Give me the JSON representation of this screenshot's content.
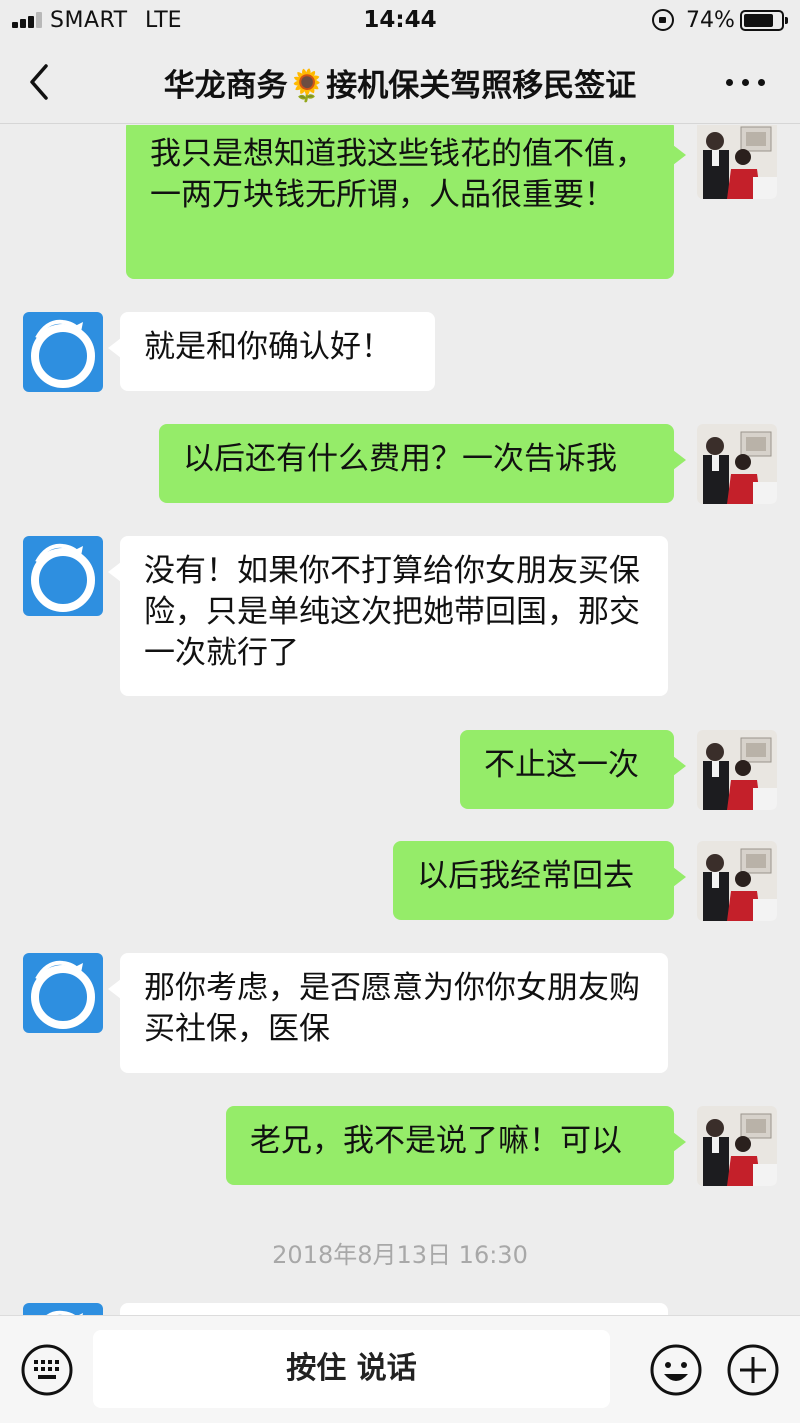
{
  "status_bar": {
    "carrier": "SMART",
    "network": "LTE",
    "time": "14:44",
    "battery_percent": "74%",
    "battery_level": 0.74,
    "signal_bars": 3
  },
  "header": {
    "title": "华龙商务🌻接机保关驾照移民签证",
    "back_icon": "chevron-left-icon",
    "more_icon": "ellipsis-icon"
  },
  "messages": [
    {
      "direction": "out",
      "text": "我只是想知道我这些钱花的值不值，一两万块钱无所谓，人品很重要！"
    },
    {
      "direction": "in",
      "text": "就是和你确认好！"
    },
    {
      "direction": "out",
      "text": "以后还有什么费用？一次告诉我"
    },
    {
      "direction": "in",
      "text": "没有！如果你不打算给你女朋友买保险，只是单纯这次把她带回国，那交一次就行了"
    },
    {
      "direction": "out",
      "text": "不止这一次"
    },
    {
      "direction": "out",
      "text": "以后我经常回去"
    },
    {
      "direction": "in",
      "text": "那你考虑，是否愿意为你你女朋友购买社保，医保"
    },
    {
      "direction": "out",
      "text": "老兄，我不是说了嘛！可以"
    }
  ],
  "timestamp": "2018年8月13日 16:30",
  "input_bar": {
    "voice_label": "按住 说话",
    "left_icon": "keyboard-icon",
    "emoji_icon": "smiley-icon",
    "add_icon": "plus-circle-icon"
  },
  "colors": {
    "background": "#ededed",
    "outgoing_bubble": "#95ec69",
    "incoming_bubble": "#ffffff",
    "contact_avatar": "#2e8fe0"
  }
}
